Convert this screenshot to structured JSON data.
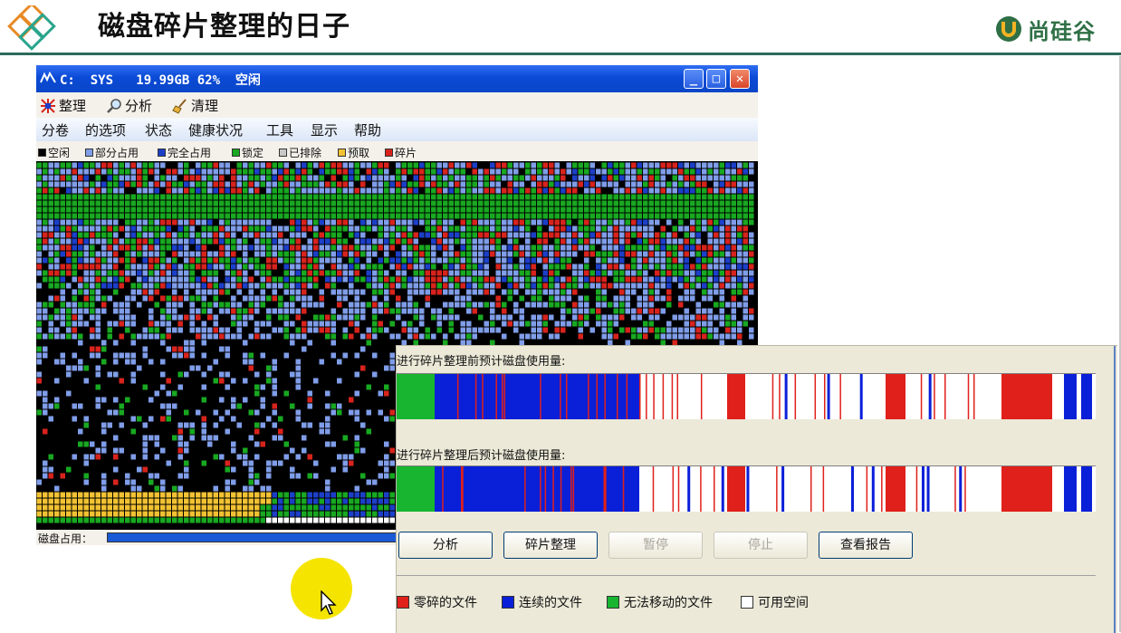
{
  "slide": {
    "title": "磁盘碎片整理的日子",
    "brand": "尚硅谷"
  },
  "defrag": {
    "window_title": "C:  SYS   19.99GB 62%  空闲",
    "toolbar": [
      {
        "label": "整理",
        "icon": "defrag-icon"
      },
      {
        "label": "分析",
        "icon": "magnifier-icon"
      },
      {
        "label": "清理",
        "icon": "broom-icon"
      }
    ],
    "menu": [
      "分卷",
      "的选项",
      "状态",
      "健康状况",
      "工具",
      "显示",
      "帮助"
    ],
    "legend": [
      {
        "label": "空闲",
        "color": "#000000"
      },
      {
        "label": "部分占用",
        "color": "#7f9de8"
      },
      {
        "label": "完全占用",
        "color": "#1c3fc9"
      },
      {
        "label": "锁定",
        "color": "#18a821"
      },
      {
        "label": "已排除",
        "color": "#c8c8c8"
      },
      {
        "label": "预取",
        "color": "#f2c232"
      },
      {
        "label": "碎片",
        "color": "#d8231c"
      }
    ],
    "disk_usage_label": "磁盘占用：",
    "disk_usage_fraction": 0.5
  },
  "analysis": {
    "before_label": "进行碎片整理前预计磁盘使用量:",
    "after_label": "进行碎片整理后预计磁盘使用量:",
    "buttons": [
      {
        "label": "分析",
        "enabled": true
      },
      {
        "label": "碎片整理",
        "enabled": true
      },
      {
        "label": "暂停",
        "enabled": false
      },
      {
        "label": "停止",
        "enabled": false
      },
      {
        "label": "查看报告",
        "enabled": true
      }
    ],
    "legend": [
      {
        "label": "零碎的文件",
        "color": "#e0201a"
      },
      {
        "label": "连续的文件",
        "color": "#0a1fd8"
      },
      {
        "label": "无法移动的文件",
        "color": "#18b530"
      },
      {
        "label": "可用空间",
        "color": "#ffffff"
      }
    ]
  }
}
